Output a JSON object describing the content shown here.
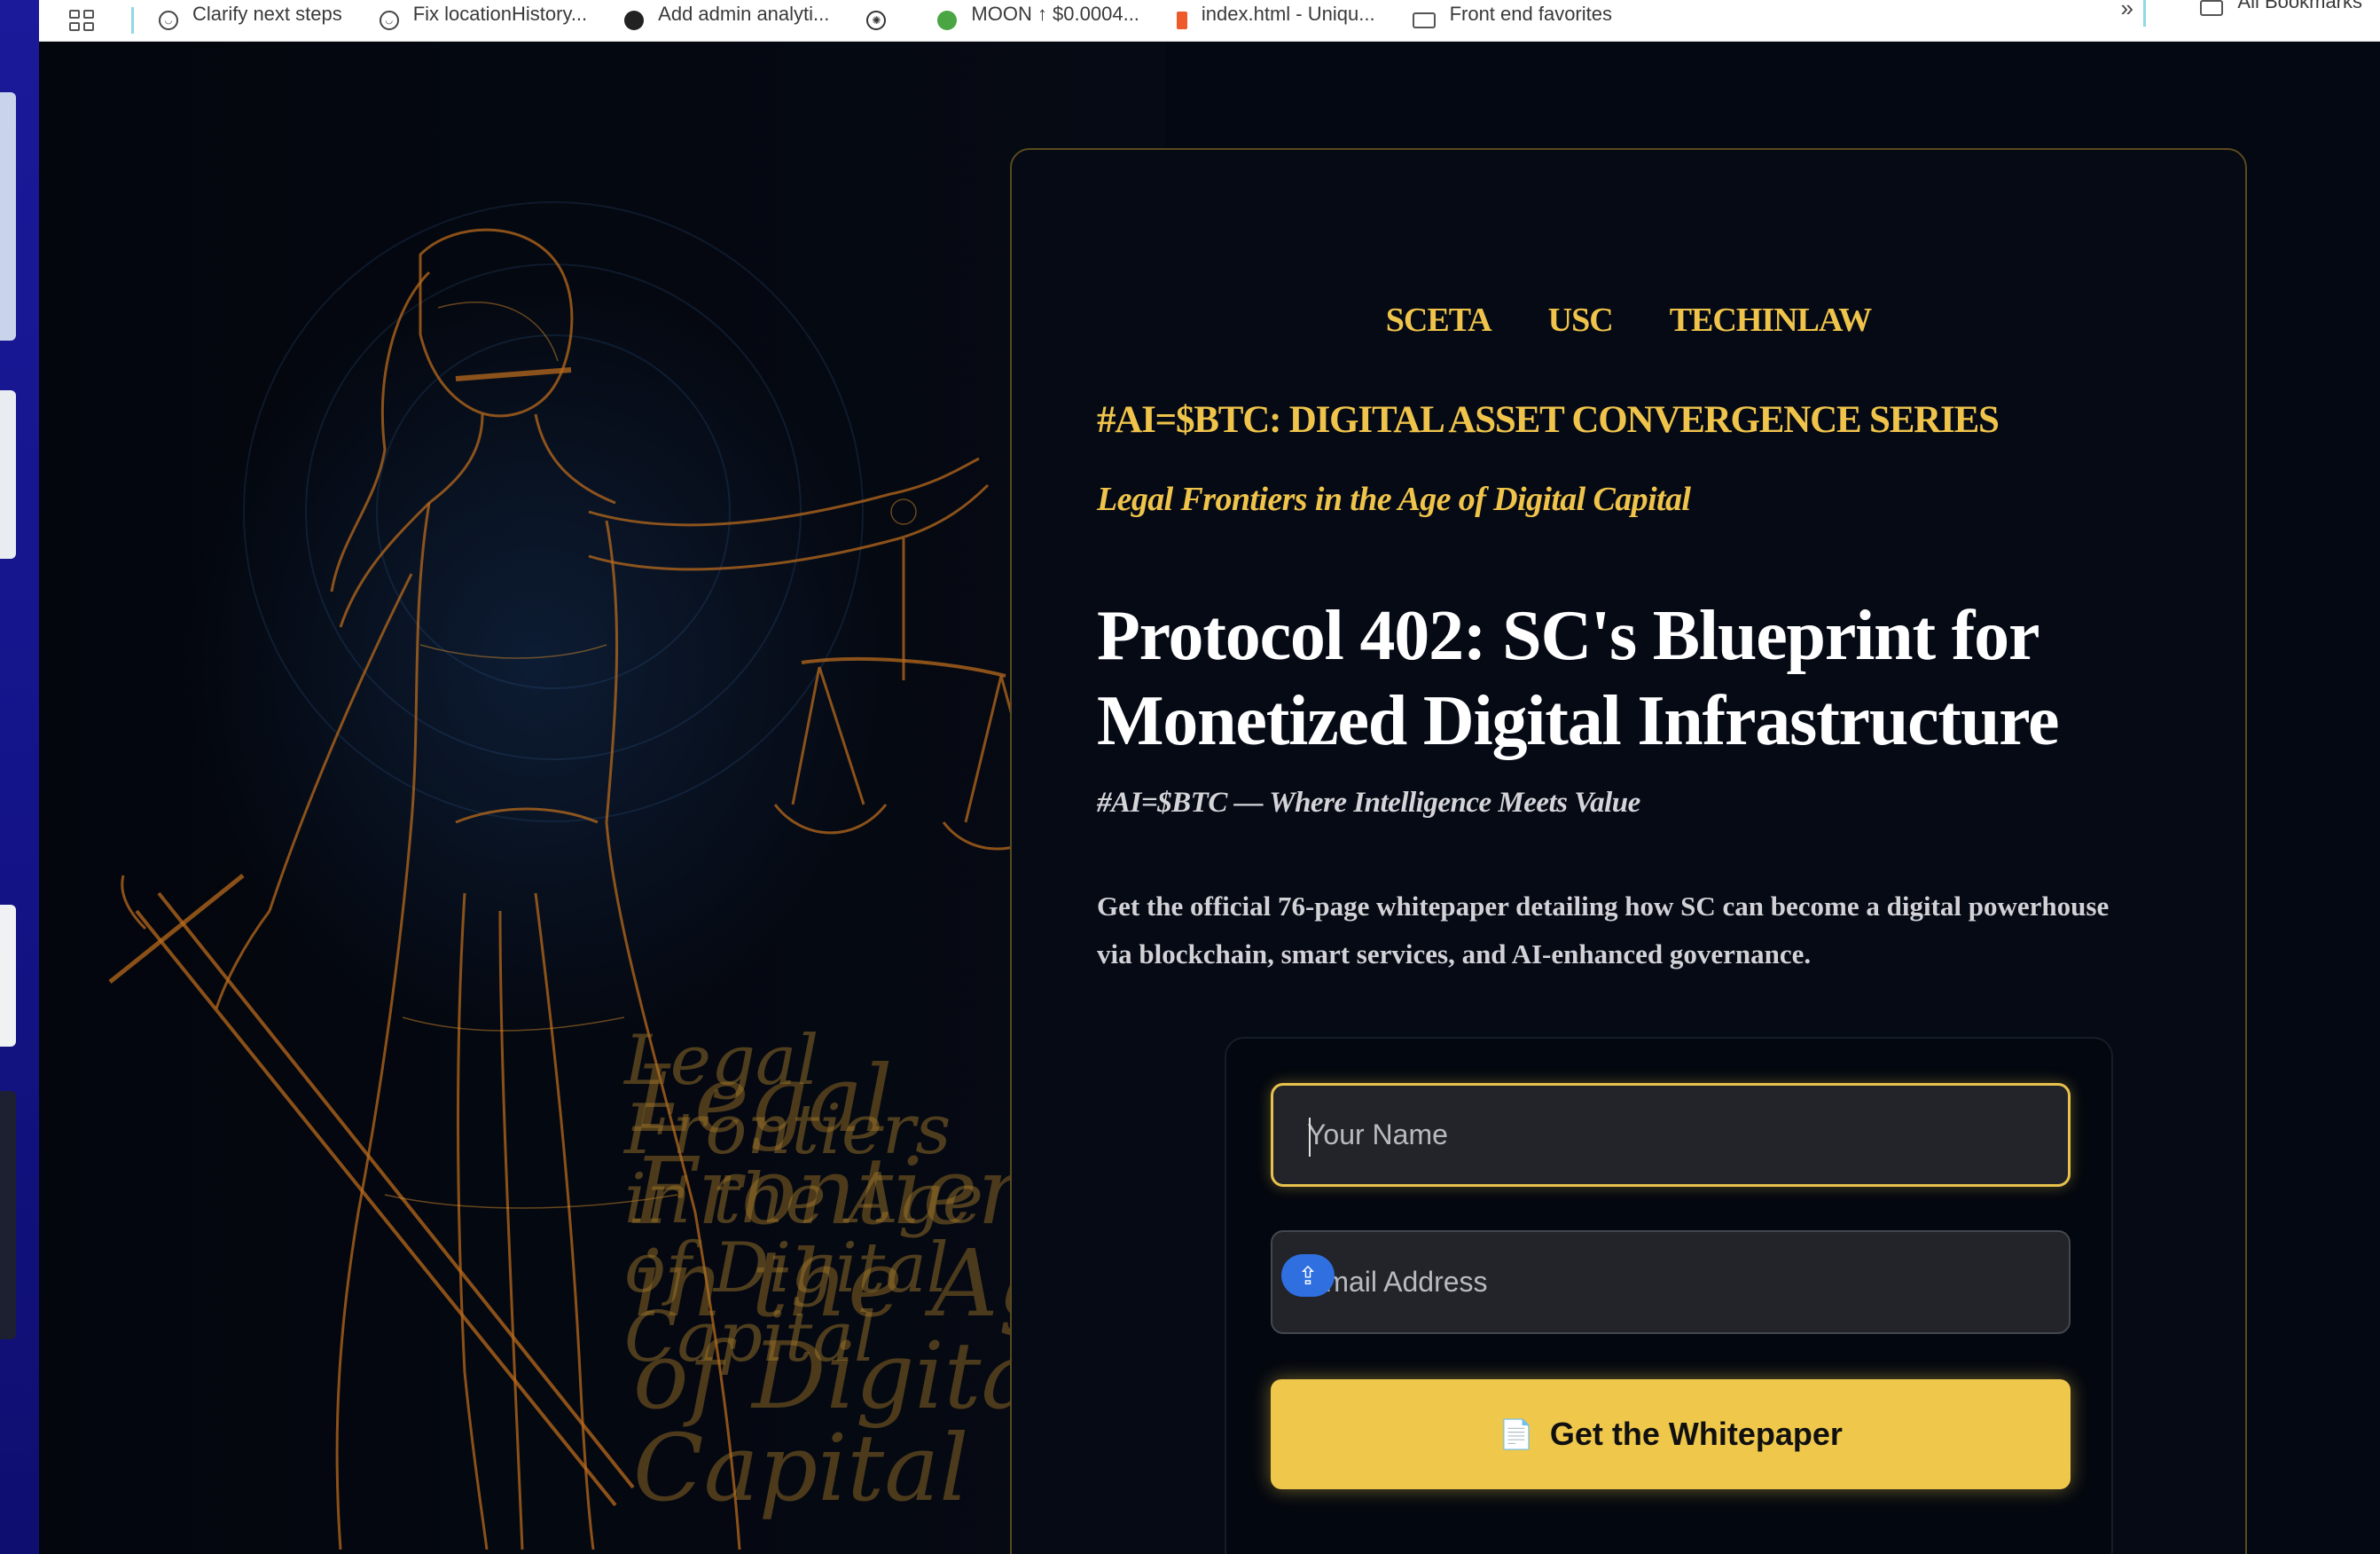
{
  "bookmarks": {
    "items": [
      {
        "label": "Clarify next steps",
        "icon": "chat-icon"
      },
      {
        "label": "Fix locationHistory...",
        "icon": "chat-icon"
      },
      {
        "label": "Add admin analyti...",
        "icon": "github-icon"
      },
      {
        "label": "",
        "icon": "openai-icon"
      },
      {
        "label": "MOON ↑ $0.0004...",
        "icon": "frog-icon"
      },
      {
        "label": "index.html - Uniqu...",
        "icon": "figma-icon"
      },
      {
        "label": "Front end favorites",
        "icon": "folder-icon"
      }
    ],
    "more": "»",
    "all_bookmarks": "All Bookmarks"
  },
  "hero": {
    "overlay_line1": "Legal",
    "overlay_line2": "Frontiers",
    "overlay_line3": "in the Age",
    "overlay_line4": "of Digital",
    "overlay_line5": "Capital"
  },
  "nav": {
    "links": [
      "SCETA",
      "USC",
      "TECHINLAW"
    ]
  },
  "content": {
    "series": "#AI=$BTC: DIGITAL ASSET CONVERGENCE SERIES",
    "tagline": "Legal Frontiers in the Age of Digital Capital",
    "headline_line1": "Protocol 402: SC's Blueprint for",
    "headline_line2": "Monetized Digital Infrastructure",
    "subhead": "#AI=$BTC — Where Intelligence Meets Value",
    "description": "Get the official 76-page whitepaper detailing how SC can become a digital powerhouse via blockchain, smart services, and AI-enhanced governance."
  },
  "form": {
    "name_placeholder": "Your Name",
    "email_placeholder": "Email Address",
    "submit_label": "Get the Whitepaper",
    "submit_icon": "📄"
  },
  "colors": {
    "accent_gold": "#f0c44a",
    "button_gold": "#eec74b",
    "background": "#040812"
  }
}
